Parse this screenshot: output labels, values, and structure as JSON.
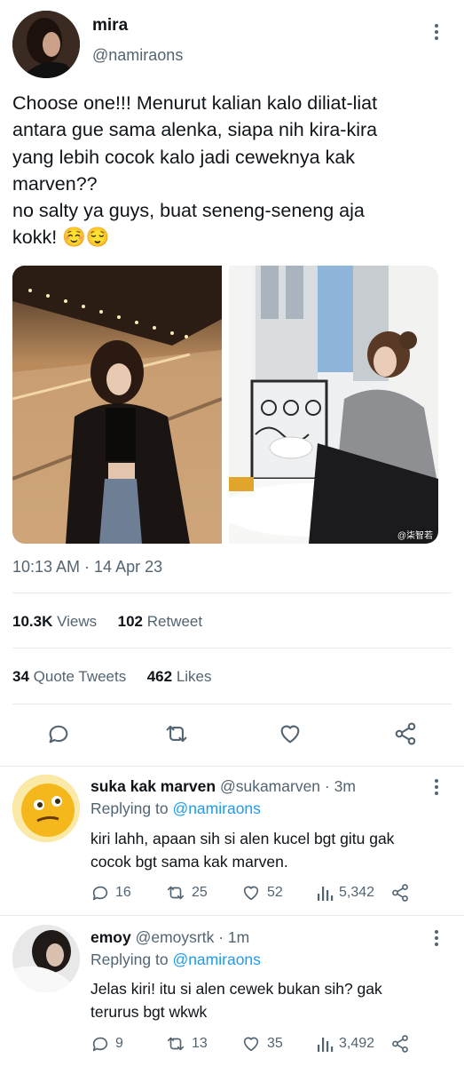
{
  "tweet": {
    "author_name": "mira",
    "author_handle": "@namiraons",
    "text_lines": [
      "Choose one!!! Menurut kalian kalo diliat-liat",
      "antara gue sama alenka, siapa nih kira-kira",
      "yang lebih cocok kalo jadi ceweknya kak",
      "marven??",
      "no salty ya guys, buat seneng-seneng aja",
      "kokk! ☺️😌"
    ],
    "timestamp": "10:13 AM · 14 Apr 23",
    "views_count": "10.3K",
    "views_label": "Views",
    "retweet_count": "102",
    "retweet_label": "Retweet",
    "quote_count": "34",
    "quote_label": "Quote Tweets",
    "likes_count": "462",
    "likes_label": "Likes",
    "photo_watermark": "@柒智若"
  },
  "replies": [
    {
      "name": "suka kak marven",
      "handle_time": "@sukamarven · 3m",
      "replying_prefix": "Replying to",
      "replying_handle": "@namiraons",
      "text_lines": [
        "kiri lahh, apaan sih si alen kucel bgt gitu gak",
        "cocok bgt sama kak marven."
      ],
      "reply_count": "16",
      "retweet_count": "25",
      "like_count": "52",
      "views_count": "5,342"
    },
    {
      "name": "emoy",
      "handle_time": "@emoysrtk · 1m",
      "replying_prefix": "Replying to",
      "replying_handle": "@namiraons",
      "text_lines": [
        "Jelas kiri! itu si alen cewek bukan sih? gak",
        "terurus bgt wkwk"
      ],
      "reply_count": "9",
      "retweet_count": "13",
      "like_count": "35",
      "views_count": "3,492"
    }
  ],
  "colors": {
    "accent": "#1d9bf0",
    "muted": "#536471",
    "text": "#0f1419",
    "divider": "#e6e9ec"
  }
}
